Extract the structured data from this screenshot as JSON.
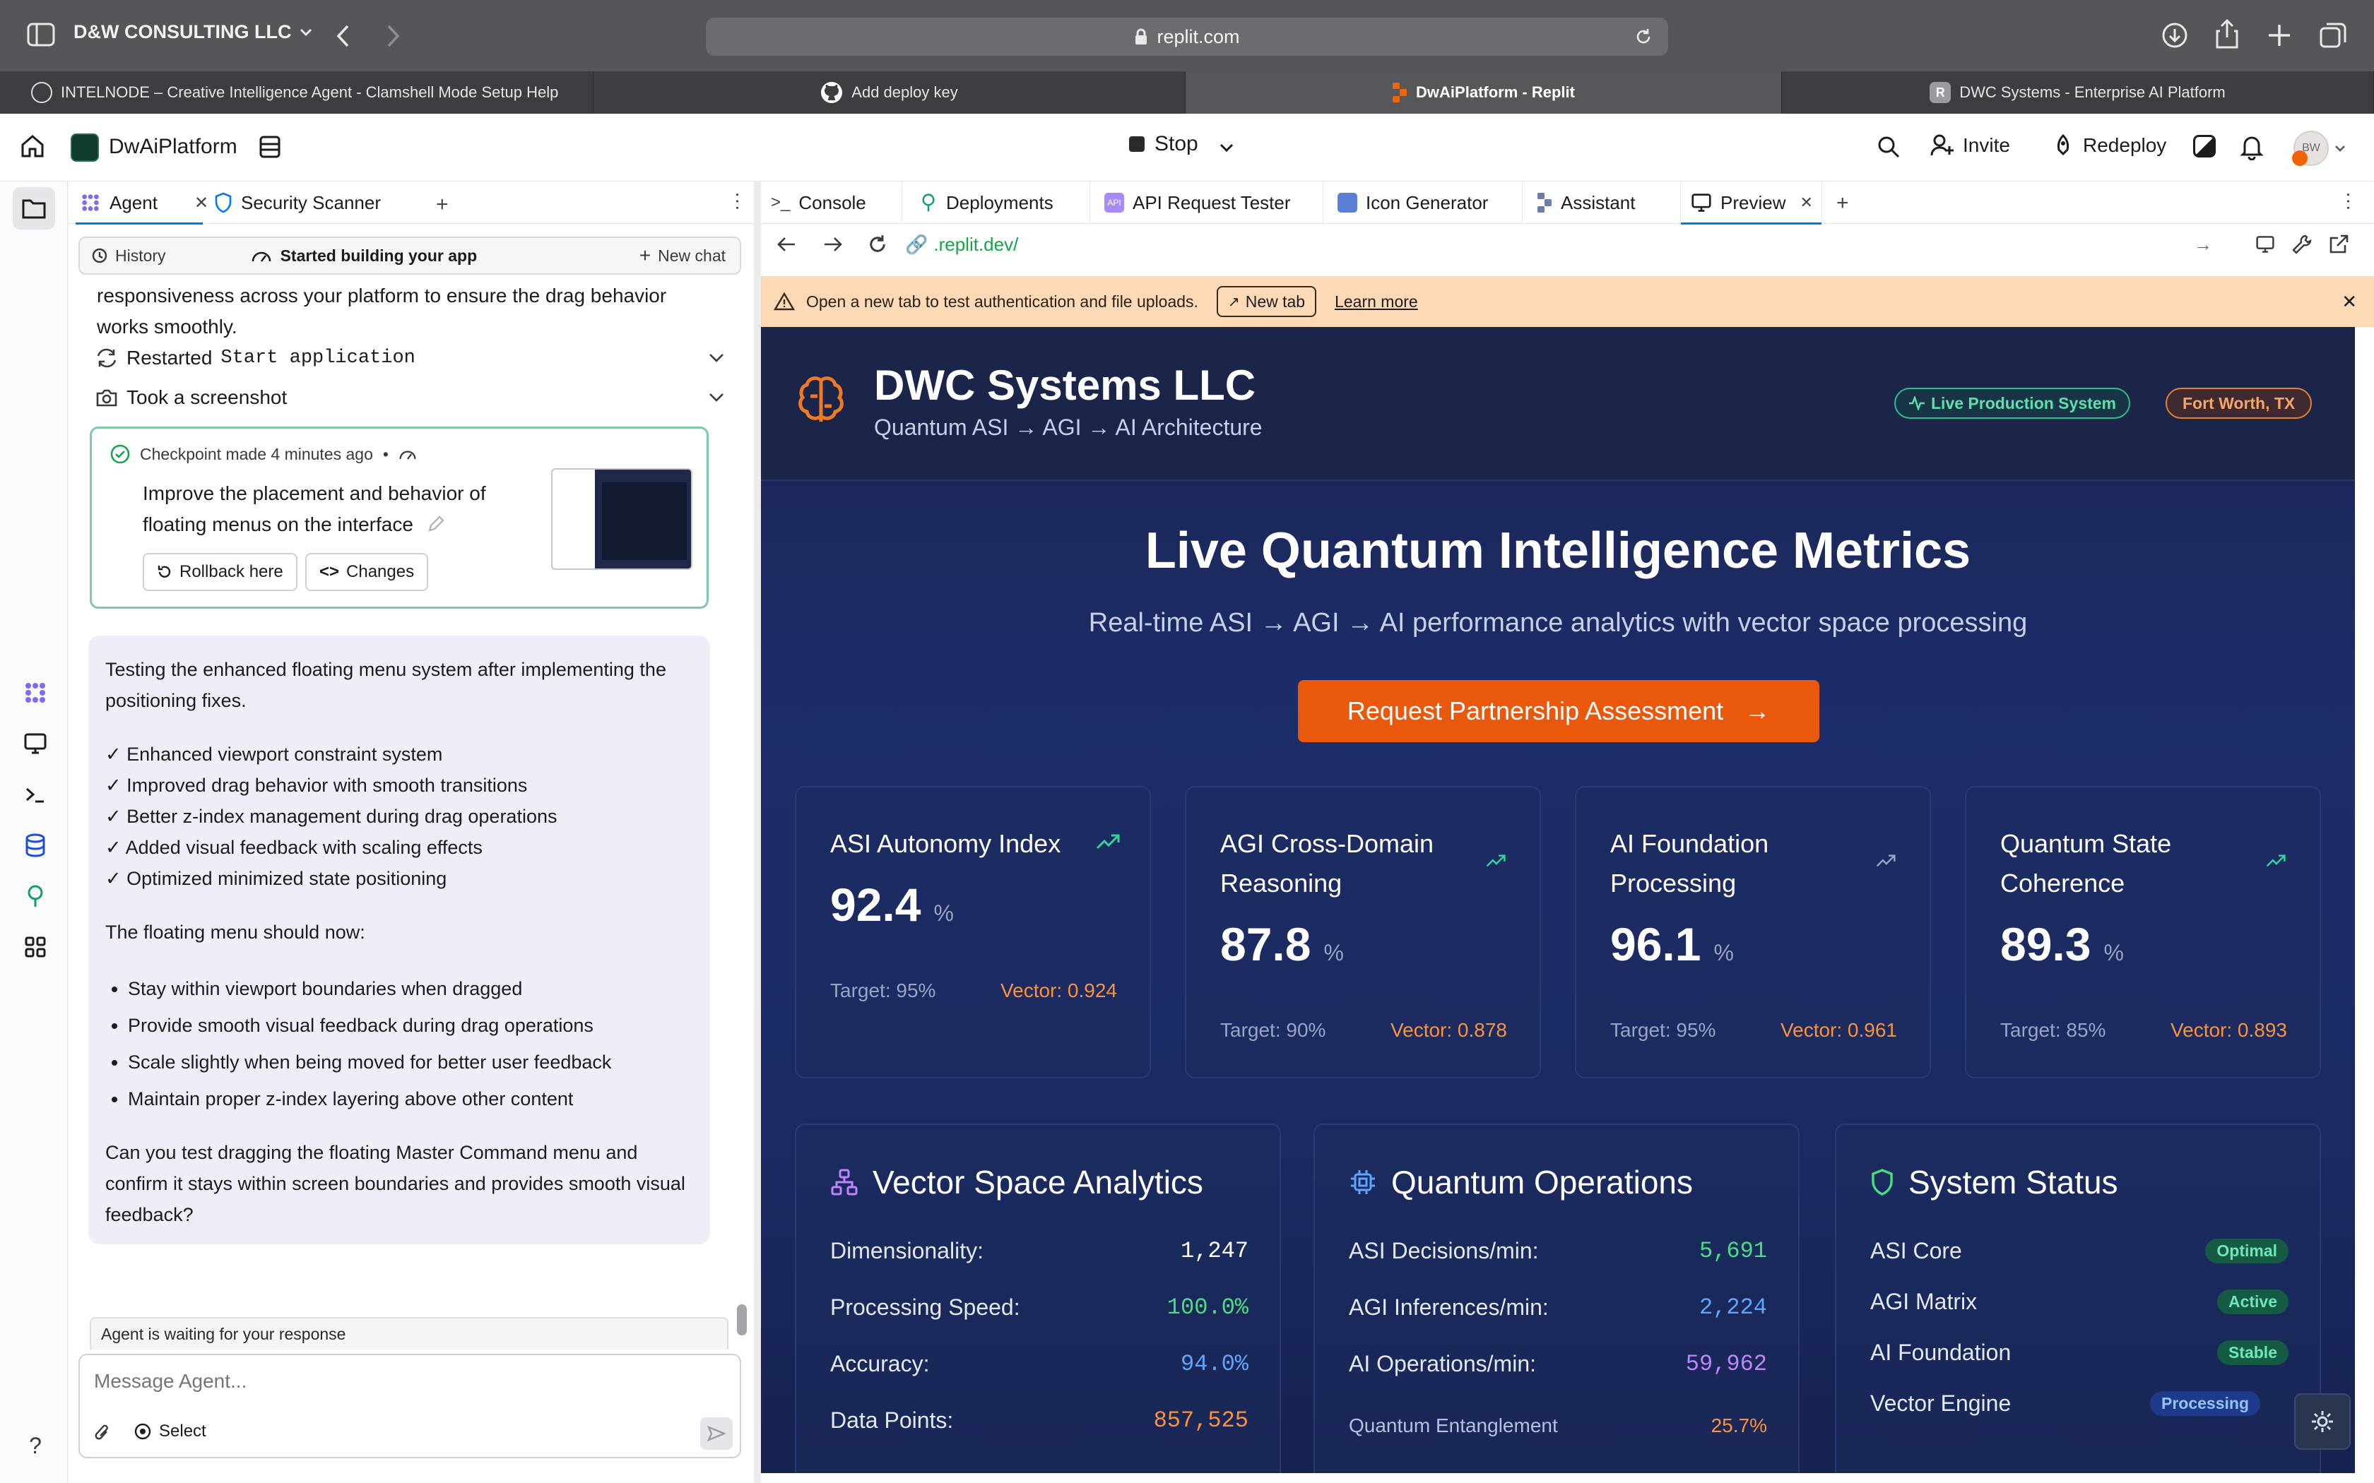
{
  "browser": {
    "profile": "D&W CONSULTING LLC",
    "url": "replit.com",
    "tabs": [
      {
        "label": "INTELNODE – Creative Intelligence Agent - Clamshell Mode Setup Help"
      },
      {
        "label": "Add deploy key"
      },
      {
        "label": "DwAiPlatform - Replit"
      },
      {
        "label": "DWC Systems - Enterprise AI Platform",
        "favicon_letter": "R"
      }
    ]
  },
  "header": {
    "project": "DwAiPlatform",
    "stop_label": "Stop",
    "invite_label": "Invite",
    "redeploy_label": "Redeploy",
    "avatar_initials": "BW"
  },
  "agent_panel": {
    "tabs": [
      {
        "label": "Agent"
      },
      {
        "label": "Security Scanner"
      }
    ],
    "history_label": "History",
    "status_label": "Started building your app",
    "new_chat_label": "New chat",
    "intro_text": "responsiveness across your platform to ensure the drag behavior works smoothly.",
    "restarted_prefix": "Restarted",
    "restarted_code": "Start application",
    "screenshot_label": "Took a screenshot",
    "checkpoint": {
      "meta": "Checkpoint made 4 minutes ago",
      "description": "Improve the placement and behavior of floating menus on the interface",
      "rollback_label": "Rollback here",
      "changes_label": "Changes"
    },
    "message": {
      "intro": "Testing the enhanced floating menu system after implementing the positioning fixes.",
      "checks": [
        "✓ Enhanced viewport constraint system",
        "✓ Improved drag behavior with smooth transitions",
        "✓ Better z-index management during drag operations",
        "✓ Added visual feedback with scaling effects",
        "✓ Optimized minimized state positioning"
      ],
      "should_now": "The floating menu should now:",
      "bullets": [
        "Stay within viewport boundaries when dragged",
        "Provide smooth visual feedback during drag operations",
        "Scale slightly when being moved for better user feedback",
        "Maintain proper z-index layering above other content"
      ],
      "question": "Can you test dragging the floating Master Command menu and confirm it stays within screen boundaries and provides smooth visual feedback?"
    },
    "waiting_label": "Agent is waiting for your response",
    "input_placeholder": "Message Agent...",
    "select_label": "Select"
  },
  "right_panel": {
    "tabs": [
      {
        "label": "Console"
      },
      {
        "label": "Deployments"
      },
      {
        "label": "API Request Tester"
      },
      {
        "label": "Icon Generator"
      },
      {
        "label": "Assistant"
      },
      {
        "label": "Preview"
      }
    ],
    "preview_url": ".replit.dev/",
    "notice": "Open a new tab to test authentication and file uploads.",
    "new_tab_label": "New tab",
    "learn_more_label": "Learn more"
  },
  "site": {
    "company": "DWC Systems LLC",
    "tagline": "Quantum ASI → AGI → AI Architecture",
    "live_badge": "Live Production System",
    "location_badge": "Fort Worth, TX",
    "hero_title": "Live Quantum Intelligence Metrics",
    "hero_subtitle": "Real-time ASI → AGI → AI performance analytics with vector space processing",
    "cta_label": "Request Partnership Assessment",
    "metrics": [
      {
        "title": "ASI Autonomy Index",
        "value": "92.4",
        "unit": "%",
        "target": "Target: 95%",
        "vector": "Vector: 0.924"
      },
      {
        "title": "AGI Cross-Domain Reasoning",
        "value": "87.8",
        "unit": "%",
        "target": "Target: 90%",
        "vector": "Vector: 0.878"
      },
      {
        "title": "AI Foundation Processing",
        "value": "96.1",
        "unit": "%",
        "target": "Target: 95%",
        "vector": "Vector: 0.961"
      },
      {
        "title": "Quantum State Coherence",
        "value": "89.3",
        "unit": "%",
        "target": "Target: 85%",
        "vector": "Vector: 0.893"
      }
    ],
    "vector_panel": {
      "title": "Vector Space Analytics",
      "rows": [
        {
          "label": "Dimensionality:",
          "value": "1,247",
          "color": "#ffffff"
        },
        {
          "label": "Processing Speed:",
          "value": "100.0%",
          "color": "#4ade80"
        },
        {
          "label": "Accuracy:",
          "value": "94.0%",
          "color": "#60a5fa"
        },
        {
          "label": "Data Points:",
          "value": "857,525",
          "color": "#fb923c"
        }
      ]
    },
    "quantum_panel": {
      "title": "Quantum Operations",
      "rows": [
        {
          "label": "ASI Decisions/min:",
          "value": "5,691",
          "color": "#4ade80"
        },
        {
          "label": "AGI Inferences/min:",
          "value": "2,224",
          "color": "#60a5fa"
        },
        {
          "label": "AI Operations/min:",
          "value": "59,962",
          "color": "#c084fc"
        }
      ],
      "entanglement_label": "Quantum Entanglement",
      "entanglement_value": "25.7%"
    },
    "status_panel": {
      "title": "System Status",
      "rows": [
        {
          "label": "ASI Core",
          "status": "Optimal"
        },
        {
          "label": "AGI Matrix",
          "status": "Active"
        },
        {
          "label": "AI Foundation",
          "status": "Stable"
        },
        {
          "label": "Vector Engine",
          "status": "Processing"
        }
      ]
    }
  },
  "colors": {
    "accent_orange": "#ea580c",
    "site_bg": "#1c2d6b",
    "replit_blue": "#0079f2"
  }
}
